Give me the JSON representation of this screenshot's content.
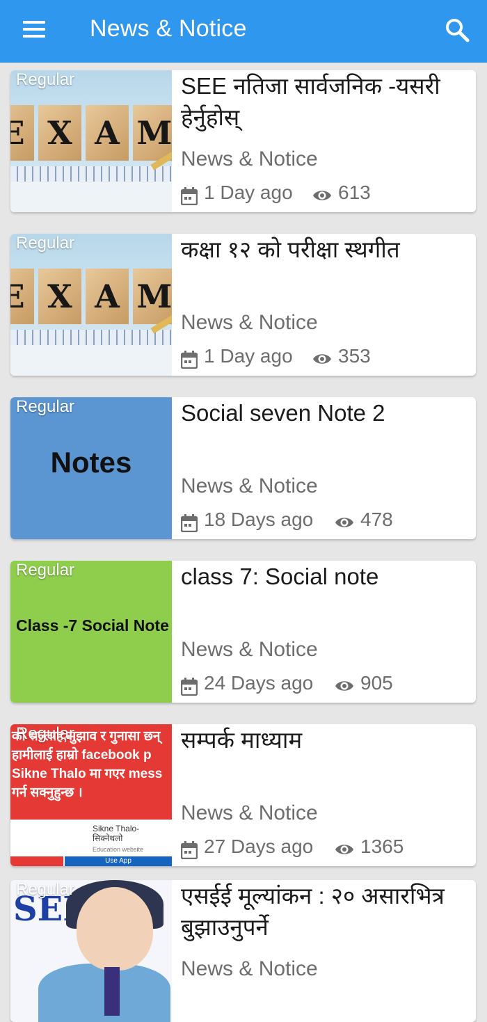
{
  "appbar": {
    "title": "News & Notice",
    "menu_icon": "menu-icon",
    "search_icon": "search-icon",
    "color": "#2f97ee"
  },
  "articles": [
    {
      "badge": "Regular",
      "title": "SEE नतिजा सार्वजनिक -यसरी हेर्नुहोस्",
      "category": "News & Notice",
      "date": "1 Day ago",
      "views": "613",
      "thumb_text": "EXAM"
    },
    {
      "badge": "Regular",
      "title": "कक्षा १२ को परीक्षा स्थगीत",
      "category": "News & Notice",
      "date": "1 Day ago",
      "views": "353",
      "thumb_text": "EXAM"
    },
    {
      "badge": "Regular",
      "title": "Social seven Note 2",
      "category": "News & Notice",
      "date": "18 Days ago",
      "views": "478",
      "thumb_text": "Notes"
    },
    {
      "badge": "Regular",
      "title": "class 7: Social note",
      "category": "News & Notice",
      "date": "24 Days ago",
      "views": "905",
      "thumb_text": "Class -7 Social Note"
    },
    {
      "badge": "Regular",
      "title": "सम्पर्क माध्याम",
      "category": "News & Notice",
      "date": "27 Days ago",
      "views": "1365",
      "thumb_lines": [
        "को सल्लाह,सुझाव र गुनासा छन्",
        "हामीलाई हाम्रो facebook p",
        "Sikne Thalo मा गएर mess",
        "गर्न सक्नुहुन्छ ।"
      ],
      "thumb_app_name": "Sikne Thalo-\nसिक्नेथलो",
      "thumb_app_sub": "Education website",
      "thumb_app_btn": "Use App"
    },
    {
      "badge": "Regular",
      "title": "एसईई मूल्यांकन : २० असारभित्र बुझाउनुपर्ने",
      "category": "News & Notice",
      "thumb_text": "SEE"
    }
  ]
}
